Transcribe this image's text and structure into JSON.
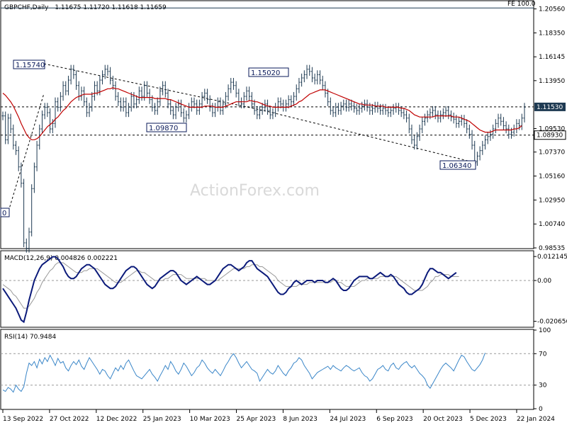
{
  "header": {
    "symbol": "GBPCHF,Daily",
    "ohlc": "1.11675 1.11720 1.11618 1.11659"
  },
  "watermark": "ActionForex.com",
  "colors": {
    "candles": "#1e3a52",
    "ma": "#c00000",
    "macd": "#0b1a7a",
    "signal": "#999999",
    "rsi": "#3a86c8",
    "level_box": "#0a1a5a",
    "current_price_bg": "#1e3a52",
    "grid": "#555555"
  },
  "chart_data": [
    {
      "type": "line",
      "panel": "price",
      "title": "GBPCHF,Daily",
      "y_ticks": [
        "1.20560",
        "1.18350",
        "1.16145",
        "1.13950",
        "1.11530",
        "1.09530",
        "1.07370",
        "1.05160",
        "1.02950",
        "1.00740",
        "0.98535"
      ],
      "ylim": [
        0.98535,
        1.2125
      ],
      "x_labels": [
        "13 Sep 2022",
        "27 Oct 2022",
        "12 Dec 2022",
        "25 Jan 2023",
        "10 Mar 2023",
        "25 Apr 2023",
        "8 Jun 2023",
        "24 Jul 2023",
        "6 Sep 2023",
        "20 Oct 2023",
        "5 Dec 2023",
        "22 Jan 2024"
      ],
      "level_labels": {
        "hi1": "1.15740",
        "hi2": "1.15020",
        "lo1": "1.09870",
        "lo2": "1.06340",
        "lo0": "0",
        "support": "1.08930",
        "current": "1.11530",
        "fe": "FE 100.0"
      },
      "levels": {
        "support": 1.0893,
        "current": 1.1153,
        "fe": 1.2065
      },
      "close": [
        1.107,
        1.085,
        1.105,
        1.095,
        1.08,
        1.075,
        1.06,
        1.045,
        0.99,
        0.985,
        1.0,
        1.04,
        1.06,
        1.08,
        1.095,
        1.108,
        1.115,
        1.11,
        1.095,
        1.1,
        1.12,
        1.115,
        1.125,
        1.135,
        1.13,
        1.14,
        1.15,
        1.145,
        1.135,
        1.125,
        1.13,
        1.12,
        1.11,
        1.115,
        1.125,
        1.135,
        1.13,
        1.14,
        1.145,
        1.15,
        1.148,
        1.14,
        1.135,
        1.125,
        1.12,
        1.115,
        1.12,
        1.11,
        1.115,
        1.125,
        1.118,
        1.122,
        1.13,
        1.125,
        1.135,
        1.128,
        1.122,
        1.115,
        1.112,
        1.12,
        1.13,
        1.135,
        1.128,
        1.118,
        1.112,
        1.108,
        1.115,
        1.118,
        1.11,
        1.105,
        1.108,
        1.115,
        1.12,
        1.118,
        1.112,
        1.118,
        1.125,
        1.128,
        1.122,
        1.115,
        1.11,
        1.115,
        1.12,
        1.112,
        1.118,
        1.125,
        1.132,
        1.138,
        1.135,
        1.128,
        1.12,
        1.118,
        1.125,
        1.13,
        1.125,
        1.118,
        1.112,
        1.108,
        1.112,
        1.115,
        1.118,
        1.112,
        1.108,
        1.11,
        1.115,
        1.12,
        1.118,
        1.115,
        1.118,
        1.122,
        1.12,
        1.125,
        1.132,
        1.138,
        1.142,
        1.145,
        1.15,
        1.148,
        1.142,
        1.14,
        1.145,
        1.14,
        1.135,
        1.128,
        1.12,
        1.112,
        1.11,
        1.115,
        1.112,
        1.116,
        1.118,
        1.115,
        1.118,
        1.116,
        1.114,
        1.112,
        1.114,
        1.116,
        1.118,
        1.115,
        1.112,
        1.114,
        1.116,
        1.114,
        1.112,
        1.114,
        1.112,
        1.11,
        1.112,
        1.114,
        1.115,
        1.112,
        1.11,
        1.108,
        1.105,
        1.095,
        1.085,
        1.08,
        1.088,
        1.095,
        1.102,
        1.105,
        1.108,
        1.11,
        1.112,
        1.108,
        1.105,
        1.108,
        1.11,
        1.112,
        1.108,
        1.106,
        1.104,
        1.1,
        1.102,
        1.104,
        1.1,
        1.095,
        1.09,
        1.08,
        1.065,
        1.07,
        1.075,
        1.08,
        1.085,
        1.088,
        1.09,
        1.095,
        1.1,
        1.105,
        1.102,
        1.098,
        1.095,
        1.09,
        1.092,
        1.095,
        1.1,
        1.098,
        1.105,
        1.115
      ],
      "ma": [
        1.128,
        1.126,
        1.123,
        1.12,
        1.116,
        1.111,
        1.106,
        1.1,
        1.095,
        1.09,
        1.087,
        1.085,
        1.085,
        1.086,
        1.088,
        1.091,
        1.094,
        1.097,
        1.099,
        1.101,
        1.104,
        1.106,
        1.109,
        1.112,
        1.114,
        1.117,
        1.12,
        1.122,
        1.124,
        1.125,
        1.126,
        1.127,
        1.127,
        1.127,
        1.127,
        1.128,
        1.128,
        1.129,
        1.13,
        1.131,
        1.132,
        1.132,
        1.133,
        1.132,
        1.132,
        1.131,
        1.13,
        1.129,
        1.128,
        1.127,
        1.126,
        1.125,
        1.124,
        1.124,
        1.124,
        1.124,
        1.124,
        1.124,
        1.123,
        1.123,
        1.123,
        1.123,
        1.123,
        1.122,
        1.122,
        1.121,
        1.12,
        1.119,
        1.118,
        1.117,
        1.116,
        1.115,
        1.115,
        1.115,
        1.115,
        1.115,
        1.115,
        1.116,
        1.116,
        1.116,
        1.116,
        1.115,
        1.115,
        1.115,
        1.115,
        1.116,
        1.117,
        1.118,
        1.119,
        1.12,
        1.12,
        1.12,
        1.12,
        1.12,
        1.121,
        1.121,
        1.12,
        1.12,
        1.119,
        1.118,
        1.117,
        1.116,
        1.116,
        1.115,
        1.115,
        1.115,
        1.115,
        1.115,
        1.115,
        1.115,
        1.116,
        1.117,
        1.118,
        1.12,
        1.121,
        1.123,
        1.125,
        1.127,
        1.128,
        1.129,
        1.13,
        1.131,
        1.131,
        1.131,
        1.13,
        1.129,
        1.128,
        1.127,
        1.126,
        1.125,
        1.124,
        1.123,
        1.122,
        1.121,
        1.12,
        1.119,
        1.118,
        1.118,
        1.117,
        1.117,
        1.117,
        1.117,
        1.116,
        1.116,
        1.116,
        1.116,
        1.115,
        1.115,
        1.115,
        1.115,
        1.115,
        1.115,
        1.114,
        1.114,
        1.113,
        1.112,
        1.11,
        1.108,
        1.107,
        1.106,
        1.106,
        1.106,
        1.106,
        1.106,
        1.106,
        1.107,
        1.107,
        1.107,
        1.107,
        1.107,
        1.107,
        1.107,
        1.106,
        1.106,
        1.106,
        1.105,
        1.104,
        1.103,
        1.102,
        1.1,
        1.098,
        1.096,
        1.094,
        1.093,
        1.092,
        1.092,
        1.092,
        1.093,
        1.094,
        1.094,
        1.094,
        1.094,
        1.094,
        1.094,
        1.094,
        1.095,
        1.095,
        1.096,
        1.098
      ]
    },
    {
      "type": "line",
      "panel": "macd",
      "title": "MACD(12,26,9) 0.004826 0.002221",
      "y_ticks": [
        "0.012145",
        "0.00",
        "-0.020656"
      ],
      "ylim": [
        -0.0233,
        0.0147
      ],
      "macd": [
        -0.004,
        -0.006,
        -0.008,
        -0.01,
        -0.012,
        -0.014,
        -0.017,
        -0.02,
        -0.021,
        -0.016,
        -0.01,
        -0.005,
        0.0,
        0.003,
        0.006,
        0.008,
        0.009,
        0.01,
        0.011,
        0.012,
        0.012,
        0.011,
        0.009,
        0.007,
        0.004,
        0.002,
        0.001,
        0.001,
        0.002,
        0.004,
        0.006,
        0.007,
        0.008,
        0.008,
        0.007,
        0.006,
        0.004,
        0.002,
        0.0,
        -0.002,
        -0.003,
        -0.004,
        -0.004,
        -0.003,
        -0.001,
        0.001,
        0.003,
        0.005,
        0.006,
        0.007,
        0.007,
        0.006,
        0.004,
        0.002,
        0.0,
        -0.002,
        -0.003,
        -0.004,
        -0.003,
        -0.001,
        0.001,
        0.002,
        0.003,
        0.004,
        0.005,
        0.005,
        0.004,
        0.002,
        0.0,
        -0.001,
        -0.002,
        -0.001,
        0.0,
        0.001,
        0.002,
        0.001,
        0.0,
        -0.001,
        -0.002,
        -0.002,
        -0.001,
        0.0,
        0.002,
        0.004,
        0.006,
        0.007,
        0.008,
        0.008,
        0.007,
        0.006,
        0.005,
        0.006,
        0.007,
        0.009,
        0.01,
        0.01,
        0.008,
        0.006,
        0.005,
        0.004,
        0.003,
        0.002,
        0.0,
        -0.002,
        -0.004,
        -0.006,
        -0.007,
        -0.007,
        -0.006,
        -0.004,
        -0.003,
        -0.001,
        0.0,
        -0.001,
        -0.002,
        -0.001,
        0.0,
        0.0,
        0.0,
        -0.001,
        0.0,
        0.0,
        0.0,
        -0.001,
        -0.001,
        0.0,
        0.001,
        0.0,
        -0.002,
        -0.004,
        -0.005,
        -0.005,
        -0.004,
        -0.002,
        0.0,
        0.001,
        0.002,
        0.002,
        0.002,
        0.002,
        0.001,
        0.001,
        0.002,
        0.003,
        0.004,
        0.003,
        0.002,
        0.002,
        0.003,
        0.002,
        0.0,
        -0.002,
        -0.003,
        -0.004,
        -0.006,
        -0.007,
        -0.007,
        -0.006,
        -0.005,
        -0.004,
        -0.002,
        0.001,
        0.004,
        0.006,
        0.006,
        0.005,
        0.004,
        0.004,
        0.003,
        0.002,
        0.001,
        0.002,
        0.003,
        0.004
      ],
      "signal": [
        -0.002,
        -0.003,
        -0.004,
        -0.005,
        -0.007,
        -0.008,
        -0.01,
        -0.012,
        -0.014,
        -0.014,
        -0.013,
        -0.011,
        -0.009,
        -0.006,
        -0.004,
        -0.001,
        0.001,
        0.003,
        0.005,
        0.006,
        0.008,
        0.009,
        0.009,
        0.009,
        0.008,
        0.007,
        0.006,
        0.005,
        0.004,
        0.004,
        0.004,
        0.005,
        0.005,
        0.006,
        0.006,
        0.006,
        0.006,
        0.005,
        0.004,
        0.003,
        0.002,
        0.001,
        0.0,
        -0.001,
        -0.001,
        -0.001,
        0.0,
        0.001,
        0.002,
        0.003,
        0.004,
        0.005,
        0.005,
        0.004,
        0.004,
        0.003,
        0.002,
        0.001,
        0.0,
        0.0,
        0.0,
        0.0,
        0.001,
        0.001,
        0.002,
        0.003,
        0.003,
        0.003,
        0.003,
        0.002,
        0.001,
        0.001,
        0.001,
        0.001,
        0.001,
        0.001,
        0.001,
        0.001,
        0.0,
        0.0,
        0.0,
        0.0,
        0.0,
        0.001,
        0.002,
        0.003,
        0.004,
        0.005,
        0.006,
        0.006,
        0.006,
        0.006,
        0.006,
        0.007,
        0.007,
        0.008,
        0.008,
        0.008,
        0.007,
        0.007,
        0.006,
        0.005,
        0.004,
        0.003,
        0.002,
        0.0,
        -0.001,
        -0.002,
        -0.003,
        -0.003,
        -0.003,
        -0.003,
        -0.003,
        -0.002,
        -0.002,
        -0.002,
        -0.002,
        -0.001,
        -0.001,
        -0.001,
        -0.001,
        -0.001,
        -0.001,
        -0.001,
        -0.001,
        -0.001,
        0.0,
        0.0,
        -0.001,
        -0.001,
        -0.002,
        -0.003,
        -0.003,
        -0.003,
        -0.003,
        -0.002,
        -0.001,
        0.0,
        0.0,
        0.001,
        0.001,
        0.001,
        0.001,
        0.001,
        0.002,
        0.002,
        0.002,
        0.002,
        0.002,
        0.002,
        0.002,
        0.001,
        0.0,
        -0.001,
        -0.002,
        -0.003,
        -0.004,
        -0.005,
        -0.005,
        -0.005,
        -0.005,
        -0.004,
        -0.003,
        -0.001,
        0.0,
        0.002,
        0.002,
        0.003,
        0.003,
        0.003,
        0.003,
        0.002,
        0.002,
        0.002,
        0.002
      ]
    },
    {
      "type": "line",
      "panel": "rsi",
      "title": "RSI(14) 70.9484",
      "y_ticks": [
        "100",
        "70",
        "30",
        "0"
      ],
      "ylim": [
        0,
        100
      ],
      "levels": [
        70,
        30
      ],
      "values": [
        24,
        22,
        27,
        25,
        21,
        30,
        25,
        22,
        28,
        45,
        58,
        55,
        60,
        52,
        63,
        57,
        65,
        60,
        68,
        62,
        55,
        64,
        58,
        60,
        52,
        48,
        55,
        60,
        56,
        62,
        54,
        50,
        58,
        65,
        60,
        55,
        50,
        44,
        50,
        48,
        42,
        38,
        45,
        52,
        48,
        55,
        50,
        58,
        62,
        55,
        48,
        42,
        40,
        38,
        42,
        46,
        50,
        44,
        40,
        35,
        42,
        48,
        55,
        50,
        60,
        55,
        48,
        44,
        50,
        58,
        54,
        48,
        42,
        46,
        52,
        55,
        62,
        58,
        52,
        48,
        45,
        50,
        46,
        42,
        48,
        55,
        60,
        66,
        70,
        65,
        58,
        52,
        56,
        60,
        55,
        50,
        48,
        45,
        35,
        40,
        45,
        50,
        46,
        44,
        48,
        55,
        50,
        45,
        42,
        48,
        52,
        58,
        60,
        65,
        62,
        55,
        50,
        45,
        38,
        42,
        46,
        48,
        50,
        52,
        54,
        50,
        55,
        52,
        50,
        48,
        52,
        55,
        53,
        50,
        48,
        50,
        52,
        46,
        42,
        40,
        35,
        38,
        44,
        50,
        52,
        55,
        50,
        48,
        55,
        58,
        52,
        50,
        55,
        58,
        60,
        55,
        52,
        55,
        50,
        45,
        42,
        38,
        30,
        26,
        32,
        38,
        44,
        50,
        55,
        58,
        55,
        52,
        48,
        55,
        62,
        68,
        66,
        60,
        55,
        50,
        48,
        52,
        56,
        62,
        71
      ]
    }
  ]
}
